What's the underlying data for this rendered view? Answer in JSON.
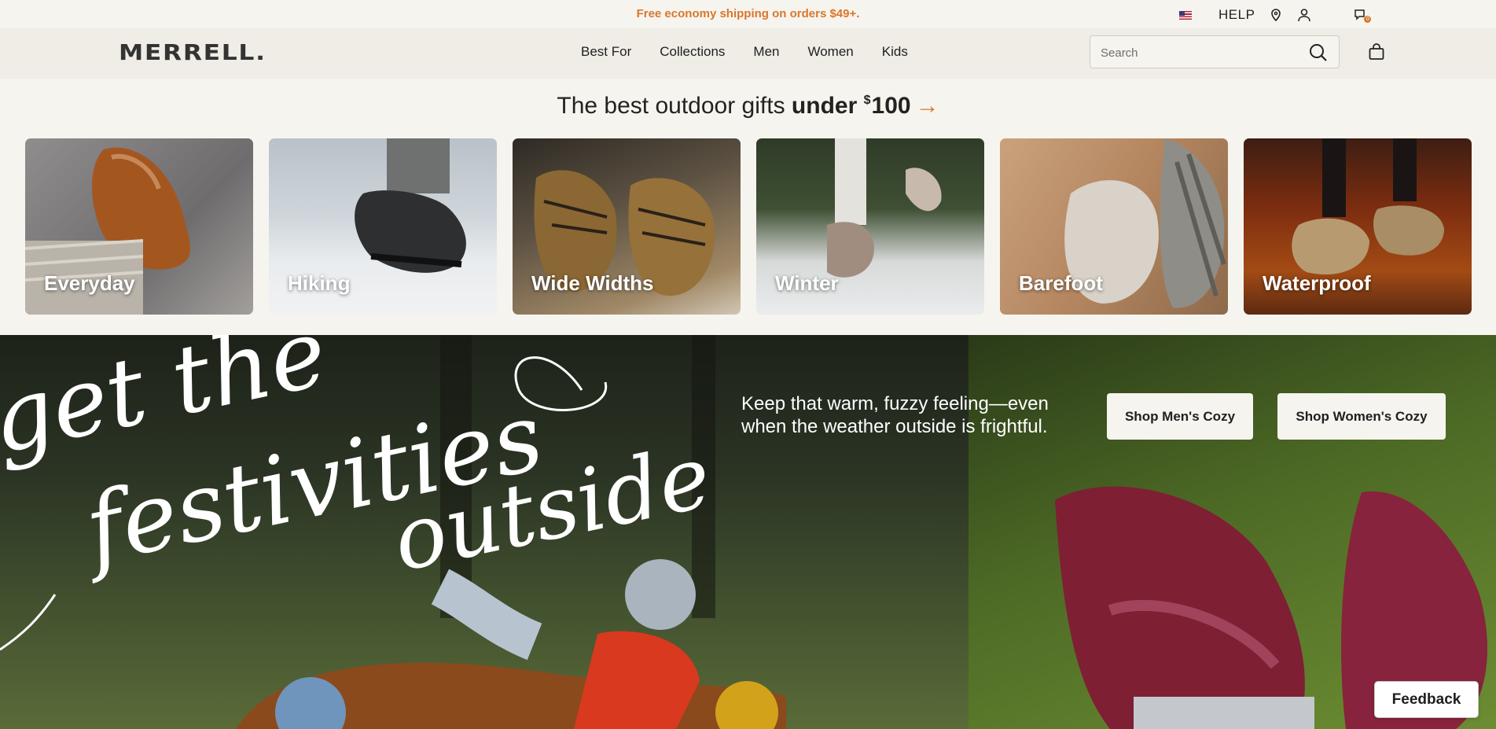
{
  "utility": {
    "promo": "Free economy shipping on orders $49+.",
    "help": "HELP",
    "chat_badge": "0"
  },
  "header": {
    "logo": "MERRELL.",
    "nav": [
      "Best For",
      "Collections",
      "Men",
      "Women",
      "Kids"
    ],
    "search_placeholder": "Search"
  },
  "gifts": {
    "prefix": "The best outdoor gifts",
    "bold": "under",
    "currency": "$",
    "amount": "100",
    "arrow": "→"
  },
  "categories": [
    "Everyday",
    "Hiking",
    "Wide Widths",
    "Winter",
    "Barefoot",
    "Waterproof"
  ],
  "hero": {
    "script_line1": "get the",
    "script_line2": "festivities",
    "script_line3": "outside",
    "copy": "Keep that warm, fuzzy feeling—even when the weather outside is frightful.",
    "btn_men": "Shop Men's Cozy",
    "btn_women": "Shop Women's Cozy"
  },
  "feedback": "Feedback",
  "colors": {
    "accent": "#d9772b",
    "background": "#f6f4ef",
    "header": "#efede6"
  },
  "icons": [
    "us-flag-icon",
    "location-pin-icon",
    "account-icon",
    "chat-icon",
    "search-icon",
    "shopping-bag-icon"
  ]
}
